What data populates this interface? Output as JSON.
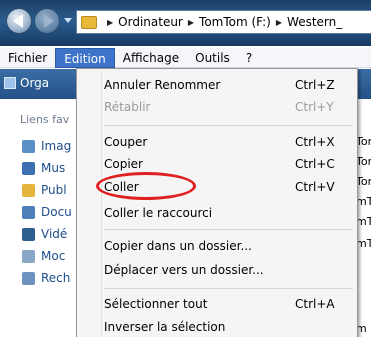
{
  "address": {
    "crumbs": [
      "Ordinateur",
      "TomTom (F:)",
      "Western_"
    ]
  },
  "menubar": {
    "items": [
      "Fichier",
      "Edition",
      "Affichage",
      "Outils",
      "?"
    ],
    "active_index": 1
  },
  "toolbar": {
    "organize_label": "Orga"
  },
  "navpane": {
    "heading": "Liens fav",
    "links": [
      "Imag",
      "Mus",
      "Publ",
      "Docu",
      "Vidé",
      "Moc",
      "Rech"
    ]
  },
  "file_column": [
    "Tor",
    "Tor",
    "Tor",
    "mT",
    "mT",
    "mT",
    "m"
  ],
  "edit_menu": {
    "items": [
      {
        "label": "Annuler Renommer",
        "shortcut": "Ctrl+Z",
        "enabled": true
      },
      {
        "label": "Rétablir",
        "shortcut": "Ctrl+Y",
        "enabled": false
      },
      {
        "label": "Couper",
        "shortcut": "Ctrl+X",
        "enabled": true
      },
      {
        "label": "Copier",
        "shortcut": "Ctrl+C",
        "enabled": true
      },
      {
        "label": "Coller",
        "shortcut": "Ctrl+V",
        "enabled": true
      },
      {
        "label": "Coller le raccourci",
        "shortcut": "",
        "enabled": true
      },
      {
        "label": "Copier dans un dossier...",
        "shortcut": "",
        "enabled": true
      },
      {
        "label": "Déplacer vers un dossier...",
        "shortcut": "",
        "enabled": true
      },
      {
        "label": "Sélectionner tout",
        "shortcut": "Ctrl+A",
        "enabled": true
      },
      {
        "label": "Inverser la sélection",
        "shortcut": "",
        "enabled": true
      }
    ],
    "highlighted_item": "Coller"
  },
  "colors": {
    "menu_active": "#3d74c9",
    "highlight_ring": "#e02020",
    "link_blue": "#1e4e8c"
  }
}
